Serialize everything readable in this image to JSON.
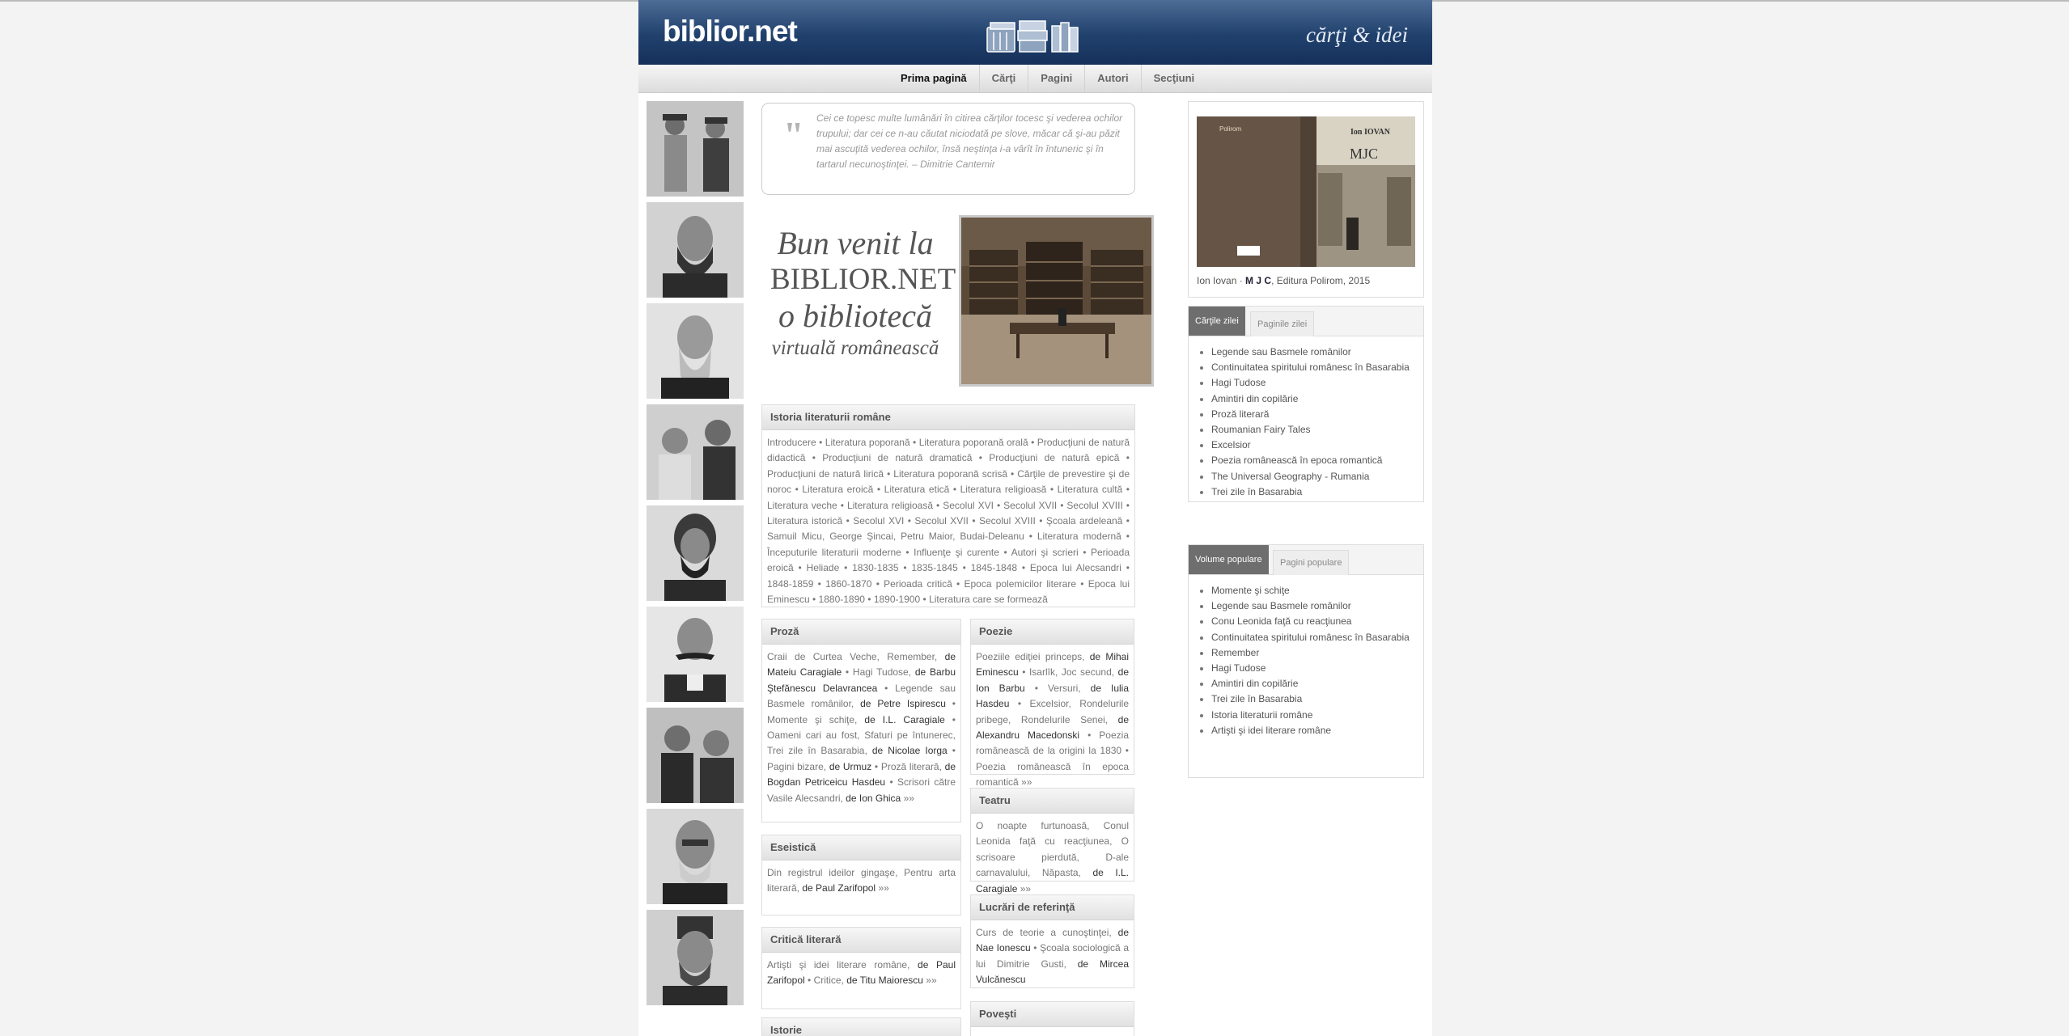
{
  "header": {
    "logo": "biblior.net",
    "tagline": "cărţi & idei"
  },
  "nav": [
    "Prima pagină",
    "Cărţi",
    "Pagini",
    "Autori",
    "Secţiuni"
  ],
  "quote": {
    "text": "Cei ce topesc multe lumânări în citirea cărţilor tocesc şi vederea ochilor trupului; dar cei ce n-au căutat niciodată pe slove, măcar că şi-au păzit mai ascuţită vederea ochilor, însă neştinţa i-a vârît în întuneric şi în tartarul necunoştinţei. – Dimitrie Cantemir"
  },
  "welcome": {
    "line1": "Bun venit la",
    "line2": "BIBLIOR.NET",
    "line3": "o bibliotecă",
    "line4": "virtuală românească"
  },
  "istoria": {
    "title": "Istoria literaturii române",
    "text": "Introducere • Literatura poporană • Literatura poporană orală • Producţiuni de natură didactică • Producţiuni de natură dramatică • Producţiuni de natură epică • Producţiuni de natură lirică • Literatura poporană scrisă • Cărţile de prevestire şi de noroc • Literatura eroică • Literatura etică • Literatura religioasă • Literatura cultă • Literatura veche • Literatura religioasă • Secolul XVI • Secolul XVII • Secolul XVIII • Literatura istorică • Secolul XVI • Secolul XVII • Secolul XVIII • Şcoala ardeleană • Samuil Micu, George Şincai, Petru Maior, Budai-Deleanu • Literatura modernă • Începuturile literaturii moderne • Influenţe şi curente • Autori şi scrieri • Perioada eroică • Heliade • 1830-1835 • 1835-1845 • 1845-1848 • Epoca lui Alecsandri • 1848-1859 • 1860-1870 • Perioada critică • Epoca polemicilor literare • Epoca lui Eminescu • 1880-1890 • 1890-1900 • Literatura care se formează"
  },
  "proza": {
    "title": "Proză",
    "items": [
      {
        "work": "Craii de Curtea Veche, Remember,",
        "by": "de Mateiu Caragiale"
      },
      {
        "work": "Hagi Tudose,",
        "by": "de Barbu Ştefănescu Delavrancea"
      },
      {
        "work": "Legende sau Basmele românilor,",
        "by": "de Petre Ispirescu"
      },
      {
        "work": "Momente şi schiţe,",
        "by": "de I.L. Caragiale"
      },
      {
        "work": "Oameni cari au fost, Sfaturi pe întunerec, Trei zile în Basarabia,",
        "by": "de Nicolae Iorga"
      },
      {
        "work": "Pagini bizare,",
        "by": "de Urmuz"
      },
      {
        "work": "Proză literară,",
        "by": "de Bogdan Petriceicu Hasdeu"
      },
      {
        "work": "Scrisori către Vasile Alecsandri,",
        "by": "de Ion Ghica"
      }
    ],
    "more": "»»"
  },
  "poezie": {
    "title": "Poezie",
    "items": [
      {
        "work": "Poeziile ediţiei princeps,",
        "by": "de Mihai Eminescu"
      },
      {
        "work": "Isarlîk, Joc secund,",
        "by": "de Ion Barbu"
      },
      {
        "work": "Versuri,",
        "by": "de Iulia Hasdeu"
      },
      {
        "work": "Excelsior, Rondelurile pribege, Rondelurile Senei,",
        "by": "de Alexandru Macedonski"
      },
      {
        "work": "Poezia românească de la origini la 1830",
        "by": ""
      },
      {
        "work": "Poezia românească în epoca romantică",
        "by": ""
      }
    ],
    "more": "»»"
  },
  "teatru": {
    "title": "Teatru",
    "items": [
      {
        "work": "O noapte furtunoasă, Conul Leonida faţă cu reacţiunea, O scrisoare pierdută, D-ale carnavalului, Năpasta,",
        "by": "de I.L. Caragiale"
      }
    ],
    "more": "»»"
  },
  "eseistica": {
    "title": "Eseistică",
    "items": [
      {
        "work": "Din registrul ideilor gingaşe, Pentru arta literară,",
        "by": "de Paul Zarifopol"
      }
    ],
    "more": "»»"
  },
  "lucrari": {
    "title": "Lucrări de referinţă",
    "items": [
      {
        "work": "Curs de teorie a cunoştinţei,",
        "by": "de Nae Ionescu"
      },
      {
        "work": "Şcoala sociologică a lui Dimitrie Gusti,",
        "by": "de Mircea Vulcănescu"
      }
    ]
  },
  "critica": {
    "title": "Critică literară",
    "items": [
      {
        "work": "Artişti şi idei literare române,",
        "by": "de Paul Zarifopol"
      },
      {
        "work": "Critice,",
        "by": "de Titu Maiorescu"
      }
    ],
    "more": "»»"
  },
  "istorie": {
    "title": "Istorie"
  },
  "povesti": {
    "title": "Poveşti"
  },
  "featured": {
    "author": "Ion Iovan",
    "sep": " · ",
    "title": "M J C",
    "rest": ", Editura Polirom, 2015",
    "cover_author": "Ion IOVAN",
    "cover_title": "MJC",
    "cover_publisher": "Polirom"
  },
  "daily": {
    "tab_active": "Cărţile zilei",
    "tab_inactive": "Paginile zilei",
    "items": [
      "Legende sau Basmele românilor",
      "Continuitatea spiritului românesc în Basarabia",
      "Hagi Tudose",
      "Amintiri din copilărie",
      "Proză literară",
      "Roumanian Fairy Tales",
      "Excelsior",
      "Poezia românească în epoca romantică",
      "The Universal Geography - Rumania",
      "Trei zile în Basarabia"
    ]
  },
  "popular": {
    "tab_active": "Volume populare",
    "tab_inactive": "Pagini populare",
    "items": [
      "Momente şi schiţe",
      "Legende sau Basmele românilor",
      "Conu Leonida faţă cu reacţiunea",
      "Continuitatea spiritului românesc în Basarabia",
      "Remember",
      "Hagi Tudose",
      "Amintiri din copilărie",
      "Trei zile în Basarabia",
      "Istoria literaturii române",
      "Artişti şi idei literare române"
    ]
  }
}
